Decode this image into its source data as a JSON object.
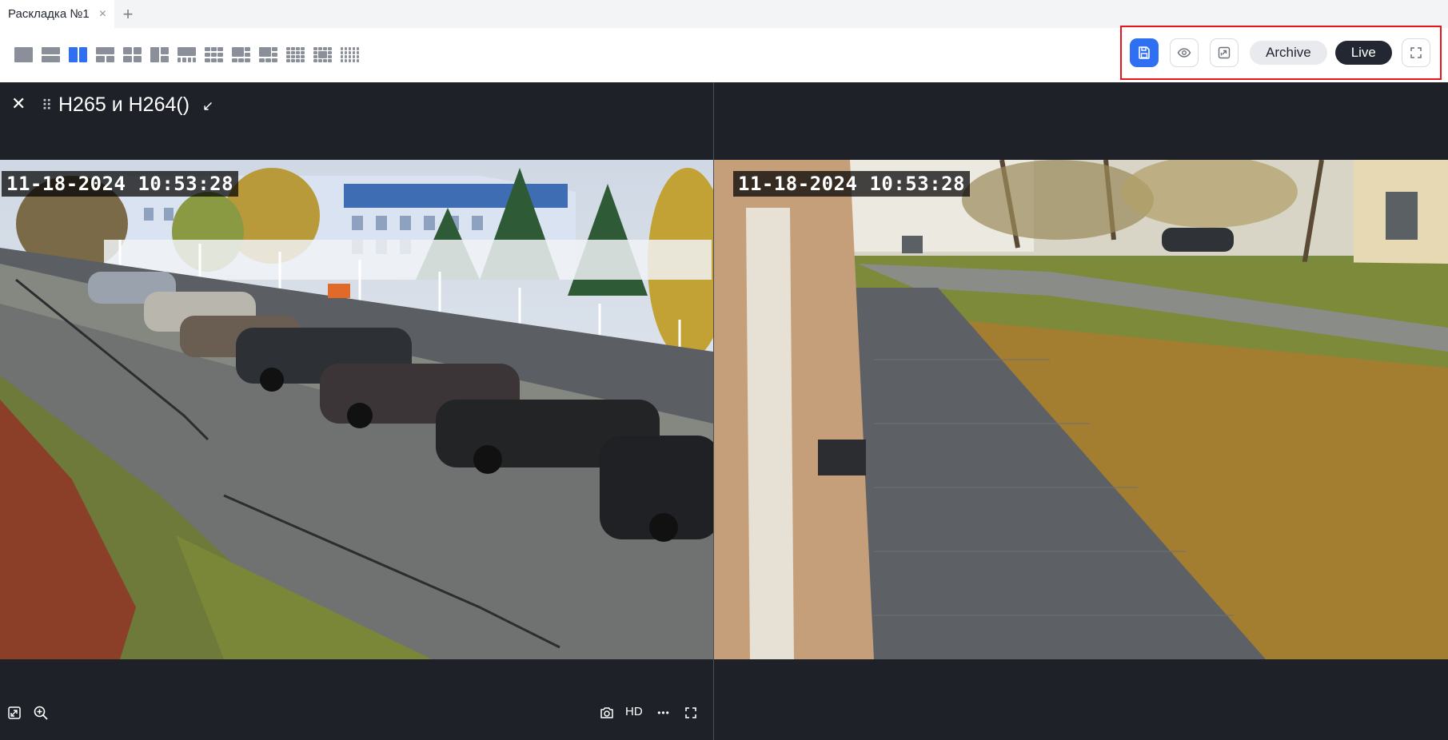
{
  "tabs": [
    {
      "label": "Раскладка №1",
      "close": "×"
    }
  ],
  "tab_add": "+",
  "layouts": [
    "1",
    "2-rows",
    "2-cols",
    "1+2",
    "4",
    "1+2-side",
    "1+4",
    "9",
    "1+5",
    "1+7",
    "16",
    "1+12",
    "20"
  ],
  "active_layout": "2-cols",
  "actions": {
    "archive_label": "Archive",
    "live_label": "Live",
    "icons": [
      "save-icon",
      "eye-icon",
      "popout-icon",
      "fullscreen-icon"
    ]
  },
  "tile": {
    "close": "✕",
    "drag": "⠿",
    "title": "H265 и H264()",
    "arrow": "↙"
  },
  "feeds": [
    {
      "timestamp": "11-18-2024 10:53:28"
    },
    {
      "timestamp": "11-18-2024 10:53:28"
    }
  ],
  "bottom_bar": {
    "hd_label": "HD",
    "more": "•••"
  },
  "colors": {
    "accent": "#2f6ff2",
    "highlight_border": "#e8141c",
    "live_pill": "#222731",
    "background": "#1e2128"
  }
}
